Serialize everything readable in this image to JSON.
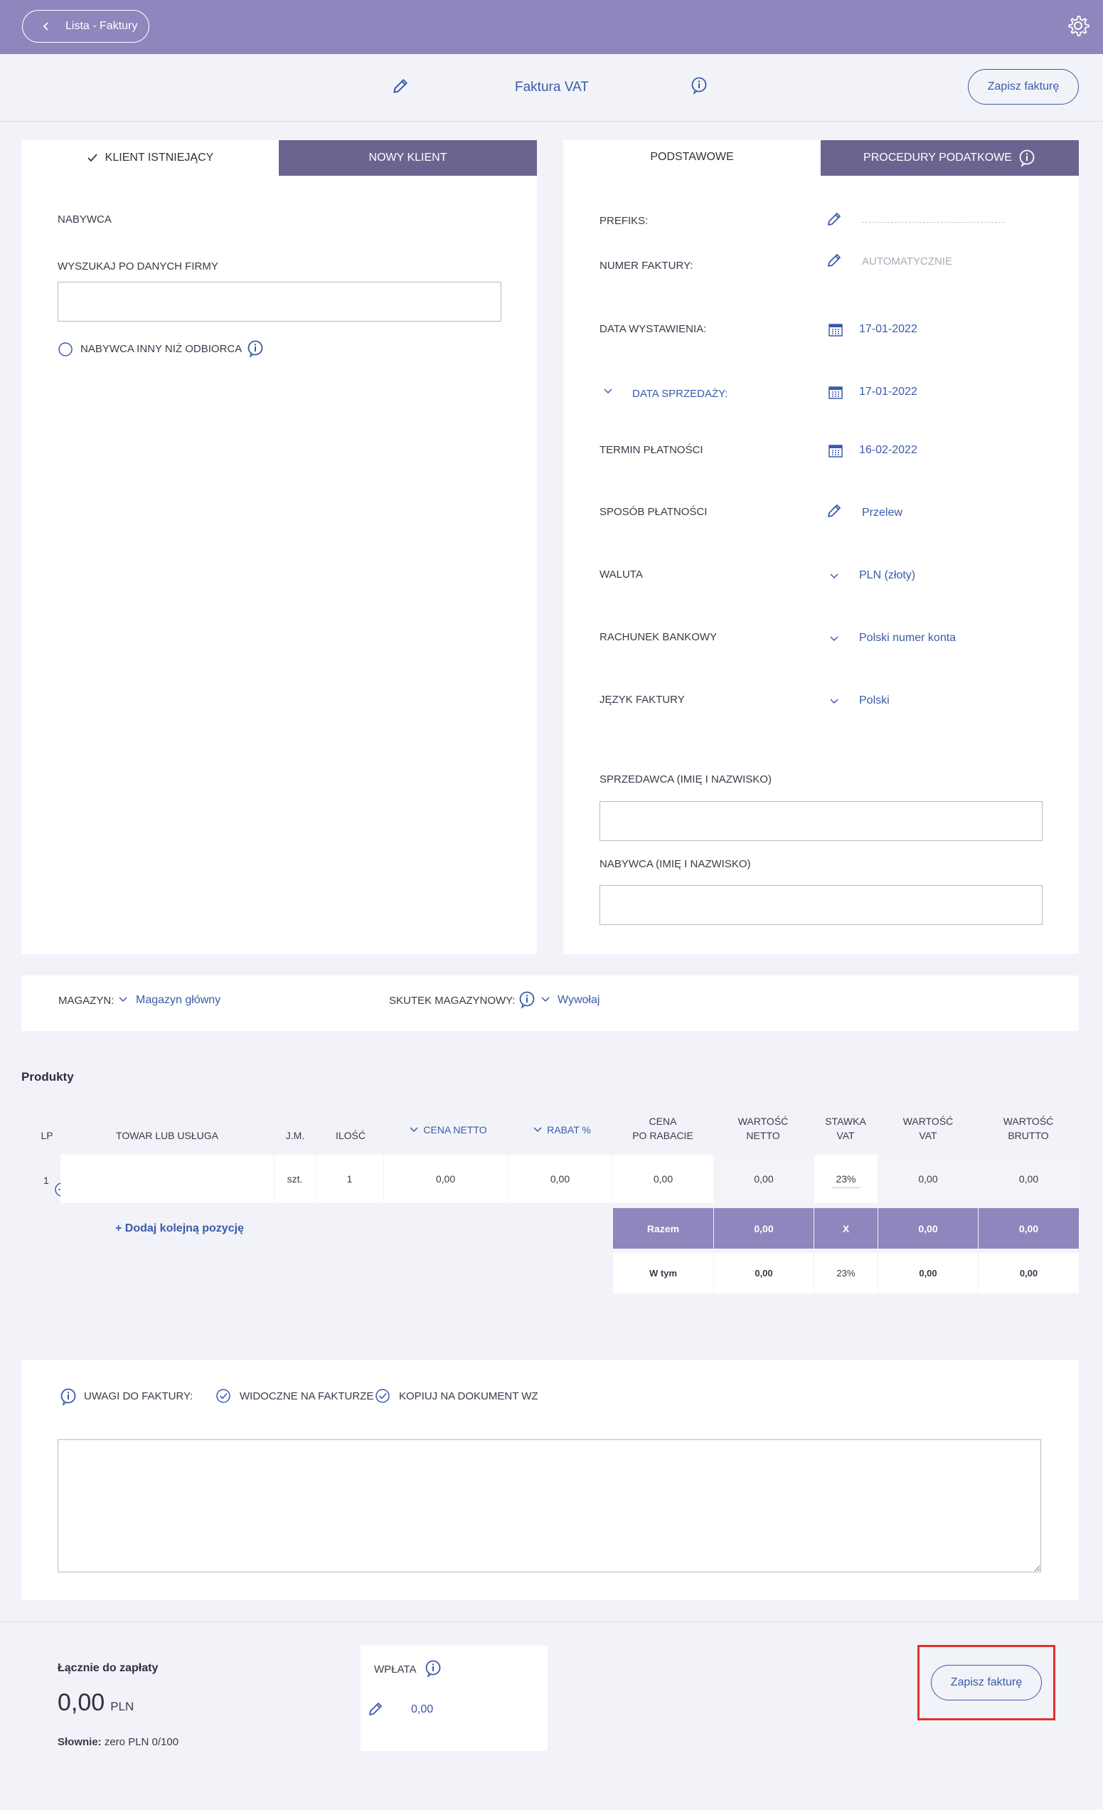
{
  "topbar": {
    "back_label": "Lista - Faktury",
    "accent": "#8e86bc"
  },
  "header": {
    "title": "Faktura VAT",
    "save_label": "Zapisz fakturę"
  },
  "client_tabs": {
    "existing": "KLIENT ISTNIEJĄCY",
    "new": "NOWY KLIENT"
  },
  "client": {
    "buyer_label": "NABYWCA",
    "search_label": "WYSZUKAJ PO DANYCH FIRMY",
    "search_value": "",
    "other_buyer_label": "NABYWCA INNY NIŻ ODBIORCA"
  },
  "details_tabs": {
    "basic": "PODSTAWOWE",
    "tax": "PROCEDURY PODATKOWE"
  },
  "details": {
    "prefix_label": "PREFIKS:",
    "number_label": "NUMER FAKTURY:",
    "number_value": "AUTOMATYCZNIE",
    "issue_date_label": "DATA WYSTAWIENIA:",
    "issue_date_value": "17-01-2022",
    "sale_date_label": "DATA SPRZEDAŻY:",
    "sale_date_value": "17-01-2022",
    "due_label": "TERMIN PŁATNOŚCI",
    "due_value": "16-02-2022",
    "payment_label": "SPOSÓB PŁATNOŚCI",
    "payment_value": "Przelew",
    "currency_label": "WALUTA",
    "currency_value": "PLN (złoty)",
    "bank_label": "RACHUNEK BANKOWY",
    "bank_value": "Polski numer konta",
    "lang_label": "JĘZYK FAKTURY",
    "lang_value": "Polski",
    "seller_label": "SPRZEDAWCA (IMIĘ I NAZWISKO)",
    "seller_value": "",
    "buyer_name_label": "NABYWCA (IMIĘ I NAZWISKO)",
    "buyer_name_value": ""
  },
  "warehouse": {
    "label": "MAGAZYN:",
    "value": "Magazyn główny",
    "effect_label": "SKUTEK MAGAZYNOWY:",
    "effect_value": "Wywołaj"
  },
  "products": {
    "title": "Produkty",
    "headers": {
      "lp": "LP",
      "item": "TOWAR LUB USŁUGA",
      "unit": "J.M.",
      "qty": "ILOŚĆ",
      "net_price": "CENA NETTO",
      "discount": "RABAT %",
      "after_discount_1": "CENA",
      "after_discount_2": "PO RABACIE",
      "net_value_1": "WARTOŚĆ",
      "net_value_2": "NETTO",
      "vat_rate_1": "STAWKA",
      "vat_rate_2": "VAT",
      "vat_value_1": "WARTOŚĆ",
      "vat_value_2": "VAT",
      "gross_value_1": "WARTOŚĆ",
      "gross_value_2": "BRUTTO"
    },
    "row": {
      "lp": "1",
      "item": "",
      "unit": "szt.",
      "qty": "1",
      "net_price": "0,00",
      "discount": "0,00",
      "after_discount": "0,00",
      "net_value": "0,00",
      "vat_rate": "23%",
      "vat_value": "0,00",
      "gross_value": "0,00"
    },
    "add_label": "+ Dodaj kolejną pozycję",
    "sum": {
      "label": "Razem",
      "net": "0,00",
      "rate": "X",
      "vat": "0,00",
      "gross": "0,00"
    },
    "incl": {
      "label": "W tym",
      "net": "0,00",
      "rate": "23%",
      "vat": "0,00",
      "gross": "0,00"
    }
  },
  "notes": {
    "label": "UWAGI DO FAKTURY:",
    "visible_label": "WIDOCZNE NA FAKTURZE",
    "copy_label": "KOPIUJ NA DOKUMENT WZ",
    "value": ""
  },
  "footer": {
    "total_label": "Łącznie do zapłaty",
    "total_value": "0,00",
    "currency": "PLN",
    "words_label": "Słownie:",
    "words_value": "zero PLN 0/100",
    "payment_label": "WPŁATA",
    "payment_value": "0,00",
    "save_label": "Zapisz fakturę"
  }
}
